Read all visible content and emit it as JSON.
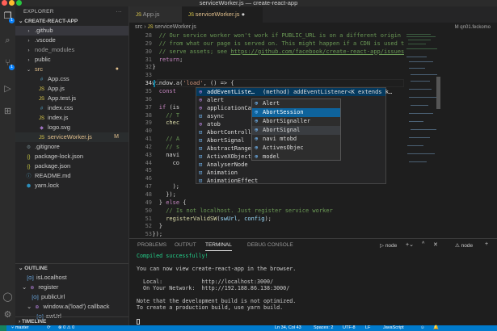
{
  "window": {
    "title": "serviceWorker.js — create-react-app"
  },
  "activity": {
    "explorer_badge": "1",
    "scm_badge": "1"
  },
  "explorer": {
    "header": "EXPLORER",
    "more": "···",
    "project": "CREATE-REACT-APP",
    "items": [
      {
        "label": ".github",
        "icon": "chevron-right",
        "depth": 0,
        "selected": true
      },
      {
        "label": ".vscode",
        "icon": "chevron-right",
        "depth": 0
      },
      {
        "label": "node_modules",
        "icon": "chevron-right",
        "depth": 0,
        "dim": true
      },
      {
        "label": "public",
        "icon": "chevron-right",
        "depth": 0
      },
      {
        "label": "src",
        "icon": "chevron-down",
        "depth": 0,
        "marker": "●",
        "color": "#e2c08d"
      },
      {
        "label": "App.css",
        "icon": "css",
        "depth": 1
      },
      {
        "label": "App.js",
        "icon": "js",
        "depth": 1
      },
      {
        "label": "App.test.js",
        "icon": "js",
        "depth": 1
      },
      {
        "label": "index.css",
        "icon": "css",
        "depth": 1
      },
      {
        "label": "index.js",
        "icon": "js",
        "depth": 1
      },
      {
        "label": "logo.svg",
        "icon": "svg",
        "depth": 1
      },
      {
        "label": "serviceWorker.js",
        "icon": "js",
        "depth": 1,
        "marker": "M",
        "color": "#e2c08d",
        "active": true
      },
      {
        "label": ".gitignore",
        "icon": "gear",
        "depth": 0
      },
      {
        "label": "package-lock.json",
        "icon": "json",
        "depth": 0
      },
      {
        "label": "package.json",
        "icon": "json",
        "depth": 0
      },
      {
        "label": "README.md",
        "icon": "info",
        "depth": 0
      },
      {
        "label": "yarn.lock",
        "icon": "yarn",
        "depth": 0
      }
    ]
  },
  "outline": {
    "header": "OUTLINE",
    "items": [
      {
        "label": "isLocalhost",
        "depth": 1,
        "icon": "variable"
      },
      {
        "label": "register",
        "depth": 0,
        "icon": "function",
        "expanded": true
      },
      {
        "label": "publicUrl",
        "depth": 2,
        "icon": "variable"
      },
      {
        "label": "window.a('load') callback",
        "depth": 1,
        "icon": "function",
        "expanded": true
      },
      {
        "label": "swUrl",
        "depth": 3,
        "icon": "variable"
      }
    ]
  },
  "timeline": {
    "header": "TIMELINE"
  },
  "tabs": [
    {
      "label": "App.js",
      "active": false
    },
    {
      "label": "serviceWorker.js",
      "active": true
    }
  ],
  "breadcrumb": {
    "folder": "src",
    "file": "serviceWorker.js"
  },
  "editor_right_label": "M qn01.feckomo",
  "code": {
    "current_line": 34,
    "lines": [
      {
        "n": 28,
        "html": "<span class='cm'>// Our service worker won't work if PUBLIC_URL is on a different origin</span>",
        "indent": 4
      },
      {
        "n": 29,
        "html": "<span class='cm'>// from what our page is served on. This might happen if a CDN is used to</span>",
        "indent": 4
      },
      {
        "n": 30,
        "html": "<span class='cm'>// serve assets; see <span class='ul'>https://github.com/facebook/create-react-app/issues</span></span>",
        "indent": 4
      },
      {
        "n": 31,
        "html": "<span class='kw'>return</span>;",
        "indent": 4
      },
      {
        "n": 32,
        "html": "}",
        "indent": 2
      },
      {
        "n": 33,
        "html": "",
        "indent": 0
      },
      {
        "n": 34,
        "html": "window.a(<span class='st'>'load'</span>, () => {",
        "indent": 2
      },
      {
        "n": 35,
        "html": "<span class='kw'>const</span>",
        "indent": 4
      },
      {
        "n": 36,
        "html": "",
        "indent": 0
      },
      {
        "n": 37,
        "html": "<span class='kw'>if</span> (is",
        "indent": 4
      },
      {
        "n": 38,
        "html": "<span class='cm'>// T</span>                                                  <span class='cm'>stil</span>",
        "indent": 6
      },
      {
        "n": 39,
        "html": "<span class='fn'>chec</span>",
        "indent": 6
      },
      {
        "n": 40,
        "html": "",
        "indent": 0
      },
      {
        "n": 41,
        "html": "<span class='cm'>// A</span>                                                  <span class='cm'>to t</span>",
        "indent": 6
      },
      {
        "n": 42,
        "html": "<span class='cm'>// s</span>",
        "indent": 6
      },
      {
        "n": 43,
        "html": "navi",
        "indent": 6
      },
      {
        "n": 44,
        "html": "co",
        "indent": 8
      },
      {
        "n": 45,
        "html": "",
        "indent": 0
      },
      {
        "n": 46,
        "html": "",
        "indent": 0
      },
      {
        "n": 47,
        "html": ");",
        "indent": 8
      },
      {
        "n": 48,
        "html": "});",
        "indent": 6
      },
      {
        "n": 49,
        "html": "} <span class='kw'>else</span> {",
        "indent": 4
      },
      {
        "n": 50,
        "html": "<span class='cm'>// Is not localhost. Just register service worker</span>",
        "indent": 6
      },
      {
        "n": 51,
        "html": "<span class='fn'>registerValidSW</span>(<span class='vr'>swUrl</span>, <span class='vr'>config</span>);",
        "indent": 6
      },
      {
        "n": 52,
        "html": "}",
        "indent": 4
      },
      {
        "n": 53,
        "html": "});",
        "indent": 2
      }
    ]
  },
  "suggest": {
    "detail": "(method) addEventListener<K extends k…",
    "items": [
      {
        "label": "addEventListe…",
        "icon": "method",
        "active": true
      },
      {
        "label": "alert",
        "icon": "method"
      },
      {
        "label": "applicationCache",
        "icon": "property"
      },
      {
        "label": "async",
        "icon": "variable"
      },
      {
        "label": "atob",
        "icon": "method"
      },
      {
        "label": "AbortController",
        "icon": "variable"
      },
      {
        "label": "AbortSignal",
        "icon": "variable"
      },
      {
        "label": "AbstractRange",
        "icon": "variable"
      },
      {
        "label": "ActiveXObject",
        "icon": "variable"
      },
      {
        "label": "AnalyserNode",
        "icon": "variable"
      },
      {
        "label": "Animation",
        "icon": "variable"
      },
      {
        "label": "AnimationEffect",
        "icon": "variable"
      }
    ]
  },
  "suggest2": {
    "items": [
      {
        "label": "Alert",
        "active": false
      },
      {
        "label": "AbortSession",
        "active": true
      },
      {
        "label": "AbortSignaller",
        "active": false
      },
      {
        "label": "AbortSignal",
        "active": false,
        "hover": true
      },
      {
        "label": "navi mtobd",
        "active": false
      },
      {
        "label": "ActivesObjec",
        "active": false
      },
      {
        "label": "model",
        "active": false
      }
    ]
  },
  "panel": {
    "tabs": [
      "PROBLEMS",
      "OUTPUT",
      "TERMINAL",
      "DEBUG CONSOLE"
    ],
    "active_tab": "TERMINAL",
    "terminal_name": "node",
    "terminal_name2": "node",
    "terminal": [
      {
        "text": "Compiled successfully!",
        "color": "#23d18b"
      },
      {
        "text": ""
      },
      {
        "text": "You can now view create-react-app in the browser."
      },
      {
        "text": ""
      },
      {
        "text": "  Local:            http://localhost:3000/"
      },
      {
        "text": "  On Your Network:  http://192.188.86.138:3000/"
      },
      {
        "text": ""
      },
      {
        "text": "Note that the development build is not optimized."
      },
      {
        "text": "To create a production build, use yarn build."
      }
    ]
  },
  "status": {
    "branch": "master",
    "sync": "⟳",
    "problems": "⊗ 0 ⚠ 0",
    "position": "Ln 34, Col 43",
    "spaces": "Spaces: 2",
    "encoding": "UTF-8",
    "eol": "LF",
    "language": "JavaScript",
    "feedback": "☺",
    "bell": "🔔"
  },
  "colors": {
    "accent": "#007acc",
    "js_icon": "#e8d44d",
    "modified": "#e2c08d"
  }
}
